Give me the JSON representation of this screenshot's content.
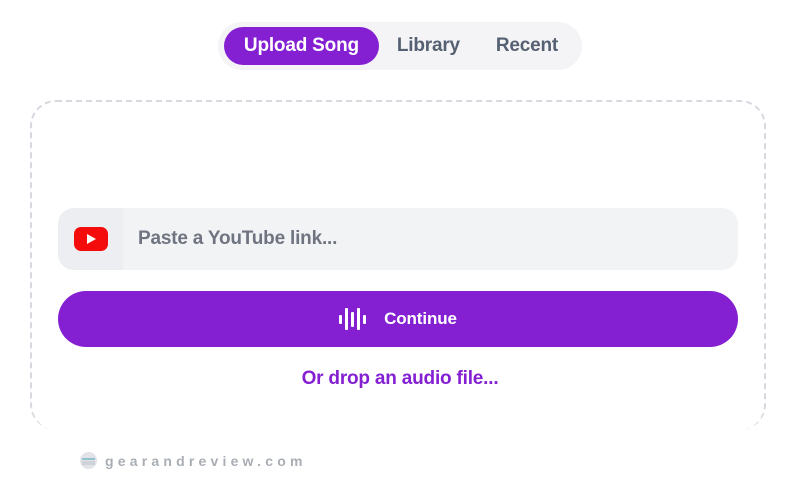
{
  "theme": {
    "accent": "#8420d2",
    "accent_text": "#ffffff",
    "tabbar_bg": "#f4f4f6",
    "tab_inactive_text": "#566073",
    "field_bg": "#f2f3f5",
    "field_icon_bg": "#edeef1",
    "placeholder_text": "#6f7480",
    "dropzone_border": "#d6d9e0",
    "youtube_red": "#f40c0c",
    "watermark_text": "#9aa0a8"
  },
  "tabs": [
    {
      "label": "Upload Song",
      "active": true
    },
    {
      "label": "Library",
      "active": false
    },
    {
      "label": "Recent",
      "active": false
    }
  ],
  "dropzone": {
    "link_field": {
      "icon": "youtube-icon",
      "placeholder": "Paste a YouTube link...",
      "value": ""
    },
    "continue_button": {
      "icon": "audio-waveform-icon",
      "label": "Continue"
    },
    "drop_link": {
      "label": "Or drop an audio file..."
    }
  },
  "watermark": {
    "icon": "site-logo-icon",
    "text": "gearandreview.com"
  }
}
